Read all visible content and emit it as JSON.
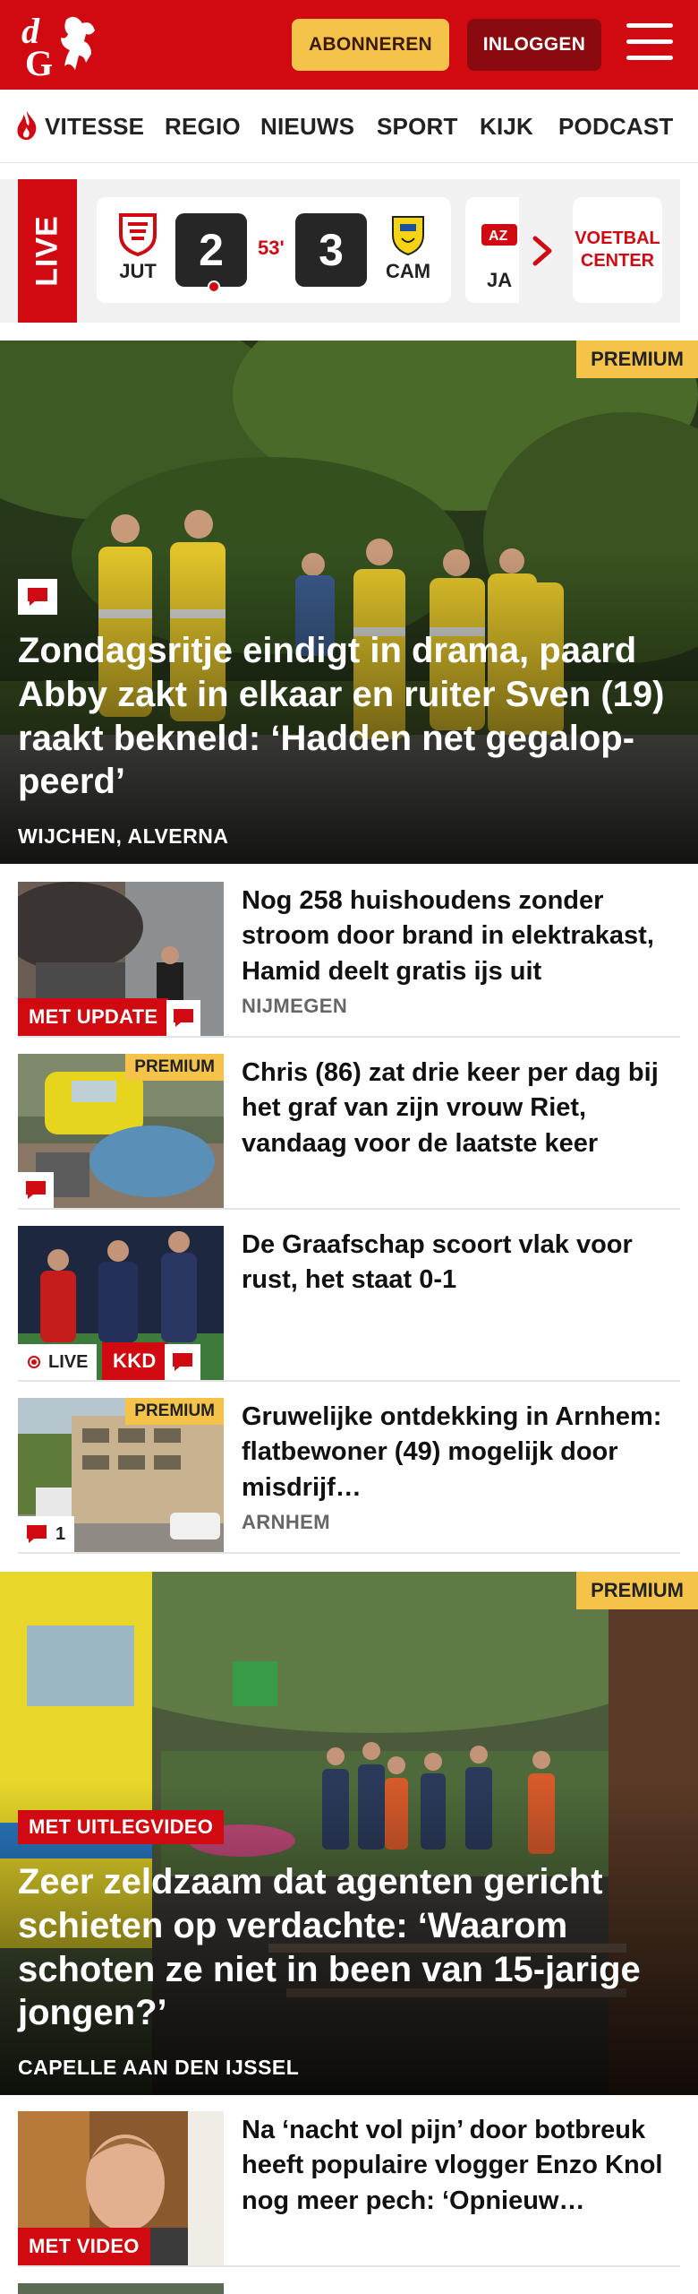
{
  "header": {
    "logo_letters": "dG",
    "subscribe_label": "ABONNEREN",
    "login_label": "INLOGGEN",
    "brand_color": "#d10a11",
    "accent_color": "#f5c24a"
  },
  "nav": {
    "items": [
      "VITESSE",
      "REGIO",
      "NIEUWS",
      "SPORT",
      "KIJK",
      "PODCAST"
    ]
  },
  "live": {
    "label": "LIVE",
    "match": {
      "home": "JUT",
      "home_score": "2",
      "minute": "53'",
      "away_score": "3",
      "away": "CAM"
    },
    "next_team": "JA",
    "voetbal_center_line1": "VOETBAL",
    "voetbal_center_line2": "CENTER"
  },
  "hero1": {
    "premium": "PREMIUM",
    "title": "Zondagsritje eindigt in drama, paard Abby zakt in elkaar en ruiter Sven (19) raakt bekneld: ‘Hadden net gegalop­peerd’",
    "location": "WIJCHEN, ALVERNA"
  },
  "articles": [
    {
      "title": "Nog 258 huishoudens zonder stroom door brand in elektra­kast, Hamid deelt gratis ijs uit",
      "location": "NIJMEGEN",
      "tag": "MET UPDATE"
    },
    {
      "title": "Chris (86) zat drie keer per dag bij het graf van zijn vrouw Riet, vandaag voor de laatste keer",
      "premium": "PREMIUM"
    },
    {
      "title": "De Graafschap scoort vlak voor rust, het staat 0-1",
      "live": "LIVE",
      "tag": "KKD"
    },
    {
      "title": "Gruwelijke ontdekking in Arnhem: flatbewoner (49) mogelijk door misdrijf…",
      "location": "ARNHEM",
      "premium": "PREMIUM",
      "comments": "1"
    }
  ],
  "hero2": {
    "premium": "PREMIUM",
    "tag": "MET UITLEGVIDEO",
    "title": "Zeer zeldzaam dat agenten gericht schieten op verdachte: ‘Waarom schoten ze niet in been van 15-jarige jongen?’",
    "location": "CAPELLE AAN DEN IJSSEL"
  },
  "article5": {
    "title": "Na ‘nacht vol pijn’ door botbreuk heeft populaire vlogger Enzo Knol nog meer pech: ‘Opnieuw…",
    "tag": "MET VIDEO"
  }
}
